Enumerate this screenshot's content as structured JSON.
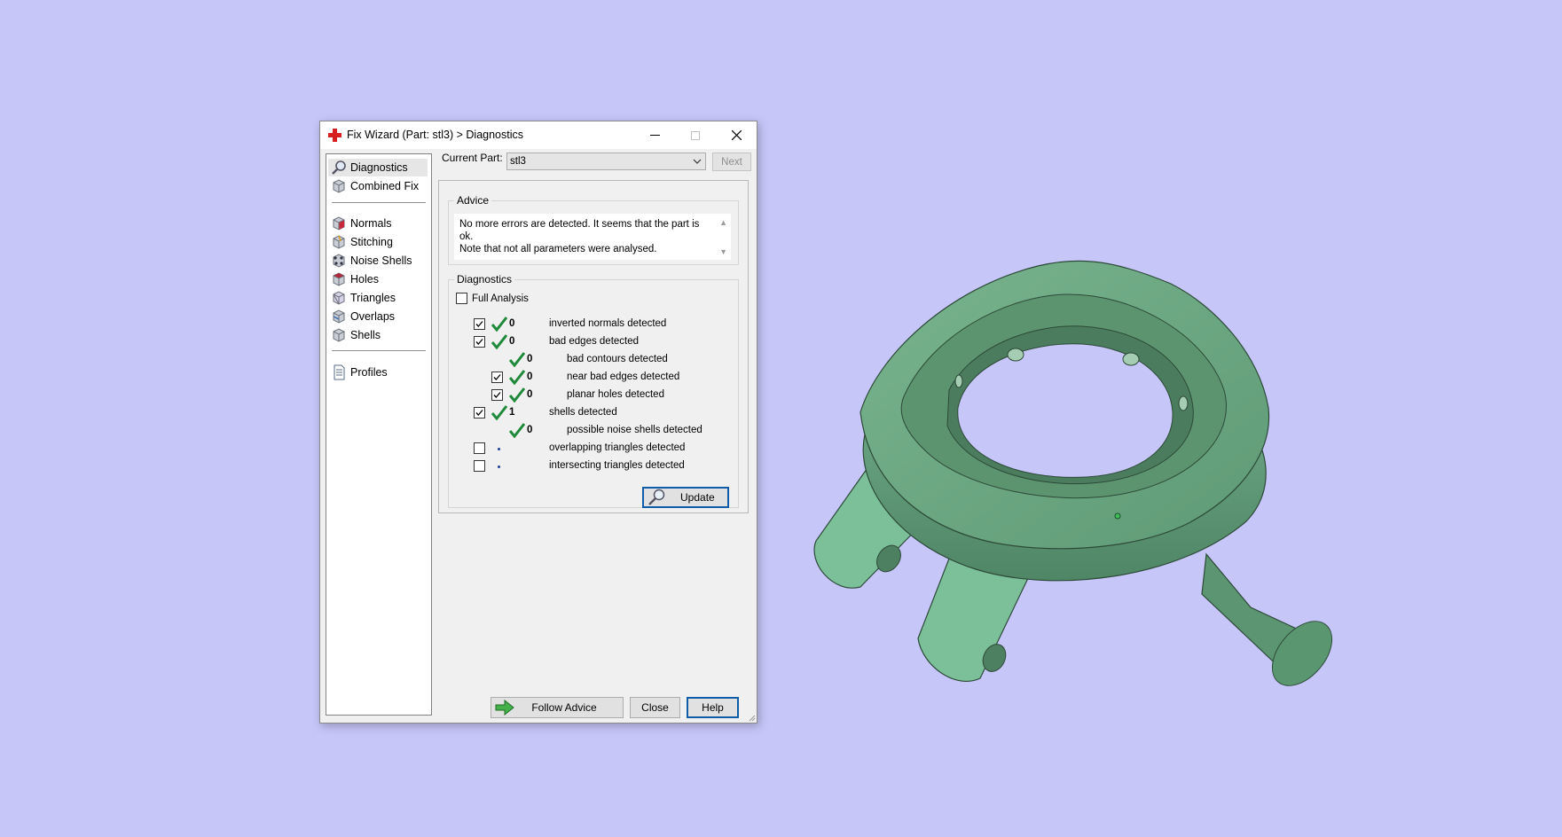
{
  "colors": {
    "background": "#c6c6f9",
    "model_green": "#6fae86",
    "check_green": "#1f8a3a",
    "accent_blue": "#0f5ca8",
    "app_icon_red": "#d81f1f"
  },
  "window": {
    "title": "Fix Wizard (Part: stl3) > Diagnostics",
    "icon": "red-cross-icon",
    "controls": [
      "minimize-icon",
      "maximize-icon",
      "close-icon"
    ]
  },
  "nav": {
    "items": [
      {
        "label": "Diagnostics",
        "icon": "magnifier-icon",
        "selected": true
      },
      {
        "label": "Combined Fix",
        "icon": "cube-icon"
      },
      {
        "label": "Normals",
        "icon": "normals-cube-icon"
      },
      {
        "label": "Stitching",
        "icon": "stitching-cube-icon"
      },
      {
        "label": "Noise Shells",
        "icon": "noise-shells-icon"
      },
      {
        "label": "Holes",
        "icon": "holes-cube-icon"
      },
      {
        "label": "Triangles",
        "icon": "triangles-cube-icon"
      },
      {
        "label": "Overlaps",
        "icon": "overlaps-cube-icon"
      },
      {
        "label": "Shells",
        "icon": "shells-cube-icon"
      },
      {
        "label": "Profiles",
        "icon": "document-icon"
      }
    ]
  },
  "toolbar": {
    "current_part_label": "Current Part:",
    "current_part_value": "stl3",
    "next_label": "Next"
  },
  "advice": {
    "title": "Advice",
    "line1": "No more errors are detected. It seems that the part is ok.",
    "line2": "Note that not all parameters were analysed."
  },
  "diagnostics": {
    "title": "Diagnostics",
    "full_analysis_label": "Full Analysis",
    "full_analysis_checked": false,
    "rows": [
      {
        "count": "0",
        "label": "inverted normals detected",
        "checked": true,
        "status": "ok"
      },
      {
        "count": "0",
        "label": "bad edges detected",
        "checked": true,
        "status": "ok"
      },
      {
        "count": "0",
        "label": "bad contours detected",
        "status": "ok"
      },
      {
        "count": "0",
        "label": "near bad edges detected",
        "checked": true,
        "status": "ok"
      },
      {
        "count": "0",
        "label": "planar holes detected",
        "checked": true,
        "status": "ok"
      },
      {
        "count": "1",
        "label": "shells detected",
        "checked": true,
        "status": "ok"
      },
      {
        "count": "0",
        "label": "possible noise shells detected",
        "status": "ok"
      },
      {
        "count": "",
        "label": "overlapping triangles detected",
        "checked": false,
        "status": "not-analysed"
      },
      {
        "count": "",
        "label": "intersecting triangles detected",
        "checked": false,
        "status": "not-analysed"
      }
    ],
    "update_label": "Update"
  },
  "footer": {
    "follow_advice_label": "Follow Advice",
    "close_label": "Close",
    "help_label": "Help"
  }
}
